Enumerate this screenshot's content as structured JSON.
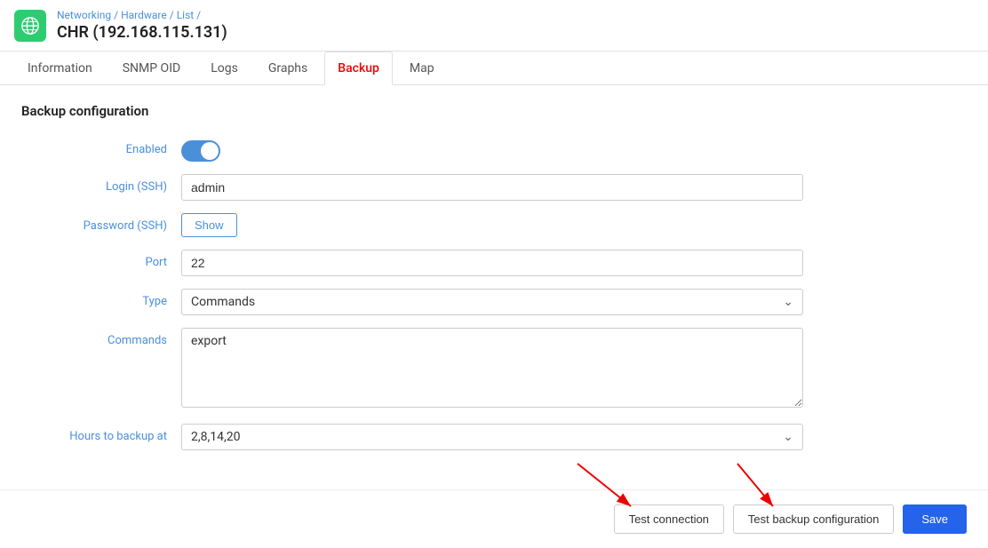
{
  "header": {
    "logo_alt": "globe-icon",
    "breadcrumb": {
      "parts": [
        "Networking",
        "Hardware",
        "List"
      ],
      "separator": "/"
    },
    "title": "CHR (192.168.115.131)"
  },
  "tabs": {
    "items": [
      {
        "id": "information",
        "label": "Information",
        "active": false
      },
      {
        "id": "snmp-oid",
        "label": "SNMP OID",
        "active": false
      },
      {
        "id": "logs",
        "label": "Logs",
        "active": false
      },
      {
        "id": "graphs",
        "label": "Graphs",
        "active": false
      },
      {
        "id": "backup",
        "label": "Backup",
        "active": true
      },
      {
        "id": "map",
        "label": "Map",
        "active": false
      }
    ]
  },
  "section": {
    "title": "Backup configuration"
  },
  "form": {
    "enabled_label": "Enabled",
    "login_label": "Login (SSH)",
    "login_value": "admin",
    "password_label": "Password (SSH)",
    "password_show_btn": "Show",
    "port_label": "Port",
    "port_value": "22",
    "type_label": "Type",
    "type_value": "Commands",
    "commands_label": "Commands",
    "commands_value": "export",
    "hours_label": "Hours to backup at",
    "hours_value": "2,8,14,20"
  },
  "actions": {
    "test_connection_label": "Test connection",
    "test_backup_label": "Test backup configuration",
    "save_label": "Save"
  }
}
